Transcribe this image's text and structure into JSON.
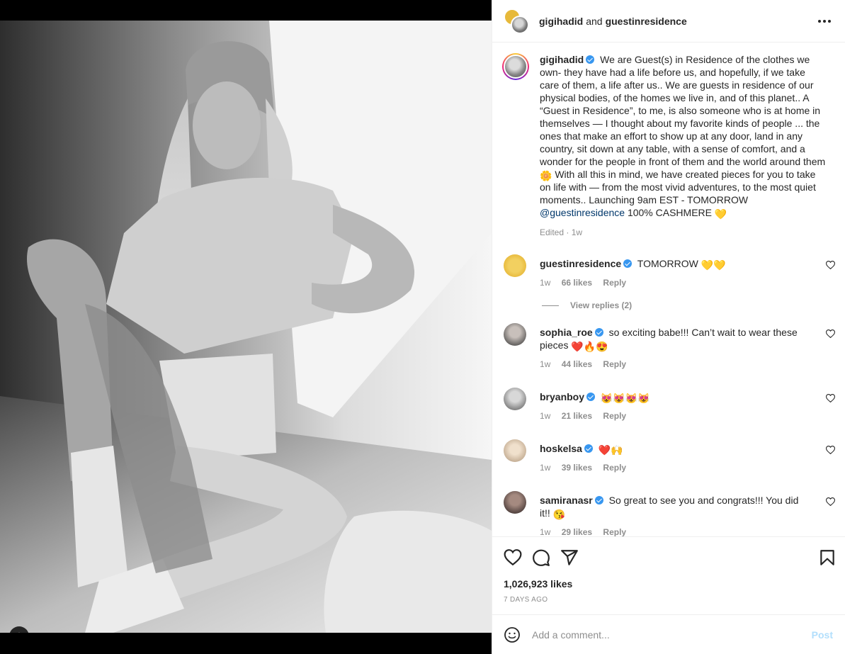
{
  "header": {
    "user1": "gigihadid",
    "joiner": "and",
    "user2": "guestinresidence"
  },
  "caption": {
    "username": "gigihadid",
    "text_1": "We are Guest(s) in Residence of the clothes we own- they have had a life before us, and hopefully, if we take care of them, a life after us.. We are guests in residence of our physical bodies, of the homes we live in, and of this planet.. A “Guest in Residence”, to me, is also someone who is at home in themselves — I thought about my favorite kinds of people ... the ones that make an effort to show up at any door, land in any country, sit down at any table, with a sense of comfort, and a wonder for the people in front of them and the world around them",
    "emoji_1": "🌼",
    "text_2": "With all this in mind, we have created pieces for you to take on life with — from the most vivid adventures, to the most quiet moments.. Launching 9am EST - TOMORROW",
    "mention": "@guestinresidence",
    "text_3": "100% CASHMERE",
    "emoji_2": "💛",
    "edited": "Edited",
    "time": "1w"
  },
  "comments": [
    {
      "username": "guestinresidence",
      "text": "TOMORROW",
      "emoji": "💛💛",
      "time": "1w",
      "likes": "66 likes",
      "reply": "Reply",
      "avatar_color": "#e7b93a"
    },
    {
      "username": "sophia_roe",
      "text": "so exciting babe!!! Can’t wait to wear these pieces",
      "emoji": "❤️🔥😍",
      "time": "1w",
      "likes": "44 likes",
      "reply": "Reply",
      "avatar_color": "#6d6a68"
    },
    {
      "username": "bryanboy",
      "text": "",
      "emoji": "😻😻😻😻",
      "time": "1w",
      "likes": "21 likes",
      "reply": "Reply",
      "avatar_color": "#8a8a8a"
    },
    {
      "username": "hoskelsa",
      "text": "",
      "emoji": "❤️🙌",
      "time": "1w",
      "likes": "39 likes",
      "reply": "Reply",
      "avatar_color": "#c9b39a"
    },
    {
      "username": "samiranasr",
      "text": "So great to see you and congrats!!! You did it!!",
      "emoji": "😘",
      "time": "1w",
      "likes": "29 likes",
      "reply": "Reply",
      "avatar_color": "#5b4a46"
    }
  ],
  "view_replies": "View replies (2)",
  "actions": {
    "like_icon": "heart-outline-icon",
    "comment_icon": "comment-bubble-icon",
    "share_icon": "paper-plane-icon",
    "save_icon": "bookmark-icon"
  },
  "likes_count": "1,026,923 likes",
  "date": "7 DAYS AGO",
  "comment_input": {
    "placeholder": "Add a comment...",
    "post_label": "Post"
  },
  "colors": {
    "verified": "#3897f0",
    "link": "#00376b",
    "muted": "#8e8e8e",
    "post_disabled": "#b2dffc"
  }
}
